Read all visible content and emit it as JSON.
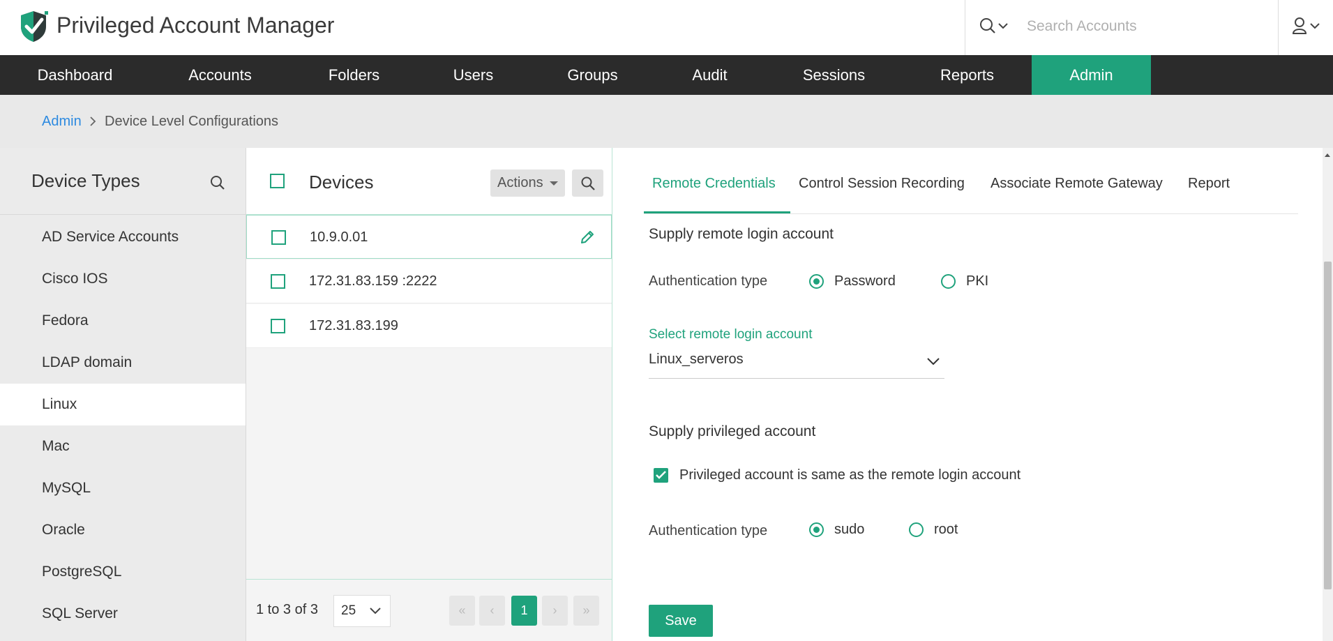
{
  "app": {
    "title": "Privileged Account Manager"
  },
  "search": {
    "placeholder": "Search Accounts"
  },
  "nav": {
    "items": [
      {
        "label": "Dashboard"
      },
      {
        "label": "Accounts"
      },
      {
        "label": "Folders"
      },
      {
        "label": "Users"
      },
      {
        "label": "Groups"
      },
      {
        "label": "Audit"
      },
      {
        "label": "Sessions"
      },
      {
        "label": "Reports"
      },
      {
        "label": "Admin",
        "active": true
      }
    ]
  },
  "breadcrumb": {
    "parent": "Admin",
    "current": "Device Level Configurations"
  },
  "device_types": {
    "title": "Device Types",
    "items": [
      {
        "label": "AD Service Accounts"
      },
      {
        "label": "Cisco IOS"
      },
      {
        "label": "Fedora"
      },
      {
        "label": "LDAP domain"
      },
      {
        "label": "Linux",
        "selected": true
      },
      {
        "label": "Mac"
      },
      {
        "label": "MySQL"
      },
      {
        "label": "Oracle"
      },
      {
        "label": "PostgreSQL"
      },
      {
        "label": "SQL Server"
      }
    ]
  },
  "devices": {
    "title": "Devices",
    "actions_label": "Actions",
    "rows": [
      {
        "label": "10.9.0.01",
        "selected": true
      },
      {
        "label": "172.31.83.159 :2222"
      },
      {
        "label": "172.31.83.199"
      }
    ],
    "pager": {
      "info": "1 to 3 of 3",
      "page_size": "25",
      "first": "«",
      "prev": "‹",
      "current": "1",
      "next": "›",
      "last": "»"
    }
  },
  "config": {
    "tabs": [
      {
        "label": "Remote Credentials",
        "active": true
      },
      {
        "label": "Control Session Recording"
      },
      {
        "label": "Associate Remote Gateway"
      },
      {
        "label": "Report"
      }
    ],
    "remote_login": {
      "title": "Supply remote login account",
      "auth_label": "Authentication type",
      "option_password": "Password",
      "option_pki": "PKI",
      "selected": "Password",
      "select_label": "Select remote login account",
      "select_value": "Linux_serveros"
    },
    "privileged": {
      "title": "Supply privileged account",
      "same_checkbox_label": "Privileged account is same as the remote login account",
      "same_checked": true,
      "auth_label": "Authentication type",
      "option_sudo": "sudo",
      "option_root": "root",
      "selected": "sudo"
    },
    "save_label": "Save"
  },
  "colors": {
    "accent": "#1fa27c",
    "nav_bg": "#2b2b2b",
    "link": "#2d8ae0"
  },
  "icons": {
    "logo": "shield-check-icon",
    "search": "search-icon",
    "user": "user-icon",
    "edit": "pencil-icon"
  }
}
